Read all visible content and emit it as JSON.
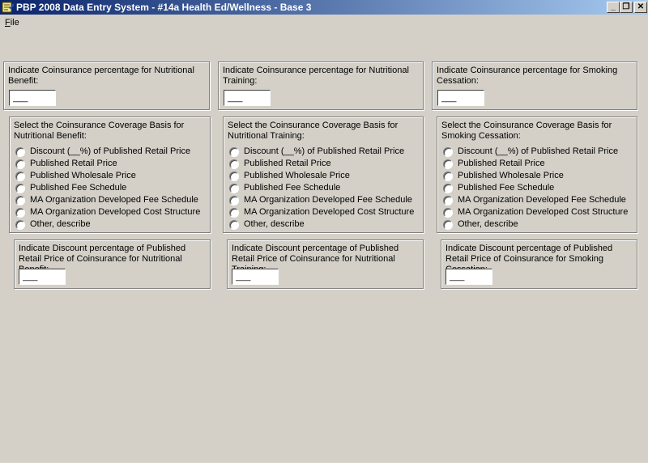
{
  "window": {
    "title": "PBP 2008 Data Entry System - #14a Health Ed/Wellness - Base 3",
    "minimize": "_",
    "restore": "❐",
    "close": "✕"
  },
  "menu": {
    "file_accel": "F",
    "file_rest": "ile"
  },
  "columns": [
    {
      "coinsurance_label": "Indicate Coinsurance percentage for Nutritional Benefit:",
      "coinsurance_value": "___",
      "basis_label": "Select the Coinsurance Coverage Basis for Nutritional Benefit:",
      "discount_label": "Indicate Discount percentage of Published Retail Price of Coinsurance for Nutritional Benefit:",
      "discount_value": "___"
    },
    {
      "coinsurance_label": "Indicate Coinsurance percentage for Nutritional Training:",
      "coinsurance_value": "___",
      "basis_label": "Select the Coinsurance Coverage Basis for Nutritional Training:",
      "discount_label": "Indicate Discount percentage of Published Retail Price of Coinsurance for Nutritional Training:",
      "discount_value": "___"
    },
    {
      "coinsurance_label": "Indicate Coinsurance percentage for Smoking Cessation:",
      "coinsurance_value": "___",
      "basis_label": "Select the Coinsurance Coverage Basis for Smoking Cessation:",
      "discount_label": "Indicate Discount percentage of Published Retail Price of Coinsurance for Smoking Cessation:",
      "discount_value": "___"
    }
  ],
  "basis_options": [
    "Discount (__%) of Published Retail Price",
    "Published Retail Price",
    "Published Wholesale Price",
    "Published Fee Schedule",
    "MA Organization Developed Fee Schedule",
    "MA Organization Developed Cost Structure",
    "Other, describe"
  ],
  "colors": {
    "background": "#d4d0c8",
    "title_gradient_start": "#0a246a",
    "title_gradient_end": "#a6caf0"
  }
}
